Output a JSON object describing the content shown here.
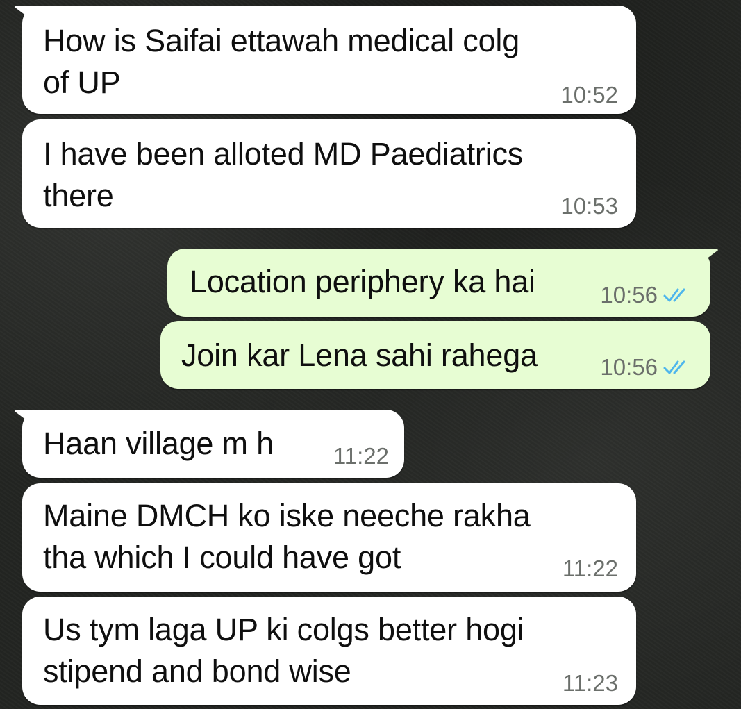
{
  "messages": [
    {
      "direction": "incoming",
      "text": "How is Saifai ettawah medical colg\nof UP",
      "time": "10:52"
    },
    {
      "direction": "incoming",
      "text": "I have been alloted MD Paediatrics\nthere",
      "time": "10:53"
    },
    {
      "direction": "outgoing",
      "text": "Location periphery ka hai",
      "time": "10:56",
      "status": "read"
    },
    {
      "direction": "outgoing",
      "text": "Join kar Lena sahi rahega",
      "time": "10:56",
      "status": "read"
    },
    {
      "direction": "incoming",
      "text": "Haan village m h",
      "time": "11:22"
    },
    {
      "direction": "incoming",
      "text": "Maine DMCH ko iske neeche rakha\ntha which I could have got",
      "time": "11:22"
    },
    {
      "direction": "incoming",
      "text": "Us tym laga UP ki colgs better hogi\nstipend and bond wise",
      "time": "11:23"
    }
  ],
  "colors": {
    "incoming_bubble": "#ffffff",
    "outgoing_bubble": "#e7fdd3",
    "read_ticks": "#4fb6ec",
    "timestamp": "#6b6f6b"
  },
  "icons": {
    "read_status": "double-check-icon"
  }
}
